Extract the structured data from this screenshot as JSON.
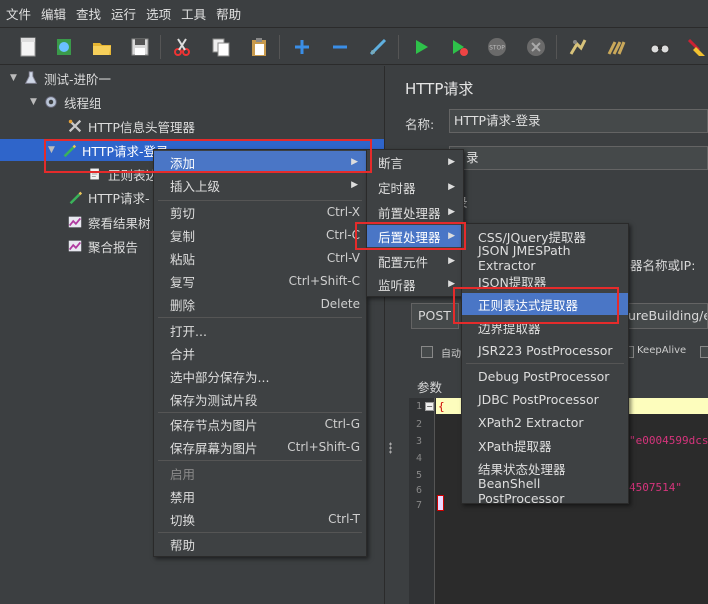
{
  "menubar": [
    "文件",
    "编辑",
    "查找",
    "运行",
    "选项",
    "工具",
    "帮助"
  ],
  "tree": {
    "root": "测试-进阶一",
    "thread_group": "线程组",
    "items": {
      "header_manager": "HTTP信息头管理器",
      "request_login": "HTTP请求-登录",
      "regex_extractor": "正则表达",
      "request_other": "HTTP请求-",
      "result_tree": "察看结果树",
      "aggregate_report": "聚合报告"
    }
  },
  "context_menu": {
    "add": "添加",
    "insert_parent": "插入上级",
    "cut": "剪切",
    "cut_key": "Ctrl-X",
    "copy": "复制",
    "copy_key": "Ctrl-C",
    "paste": "粘贴",
    "paste_key": "Ctrl-V",
    "duplicate": "复写",
    "duplicate_key": "Ctrl+Shift-C",
    "delete": "删除",
    "delete_key": "Delete",
    "open": "打开...",
    "merge": "合并",
    "save_selection": "选中部分保存为...",
    "save_fragment": "保存为测试片段",
    "save_node_image": "保存节点为图片",
    "save_node_image_key": "Ctrl-G",
    "save_screen_image": "保存屏幕为图片",
    "save_screen_image_key": "Ctrl+Shift-G",
    "enable": "启用",
    "disable": "禁用",
    "toggle": "切换",
    "toggle_key": "Ctrl-T",
    "help": "帮助"
  },
  "add_submenu": {
    "assertion": "断言",
    "timer": "定时器",
    "preprocessor": "前置处理器",
    "postprocessor": "后置处理器",
    "config_element": "配置元件",
    "listener": "监听器"
  },
  "post_submenu": {
    "css_jquery": "CSS/JQuery提取器",
    "json_jmespath": "JSON JMESPath Extractor",
    "json": "JSON提取器",
    "regex": "正则表达式提取器",
    "boundary": "边界提取器",
    "jsr223": "JSR223 PostProcessor",
    "debug": "Debug PostProcessor",
    "jdbc": "JDBC PostProcessor",
    "xpath2": "XPath2 Extractor",
    "xpath": "XPath提取器",
    "result_status": "结果状态处理器",
    "beanshell": "BeanShell PostProcessor"
  },
  "right_panel": {
    "title": "HTTP请求",
    "name_label": "名称:",
    "name_value": "HTTP请求-登录",
    "comment_fragment": "录",
    "basic_fragment": "录",
    "server_label": "器名称或IP:",
    "method": "POST",
    "path_fragment": "ureBuilding/ep",
    "auto_label": "自动",
    "keepalive_label": "KeepAlive",
    "params_tab": "参数",
    "code_line1": "{",
    "code_frag3": "\"e0004599dcs",
    "code_frag6": "4507514\"",
    "line_numbers": [
      "1",
      "2",
      "3",
      "4",
      "5",
      "6",
      "7"
    ]
  },
  "colors": {
    "highlight": "#4a76c6",
    "selection": "#2f65ca",
    "annotation": "#e52b2b"
  }
}
